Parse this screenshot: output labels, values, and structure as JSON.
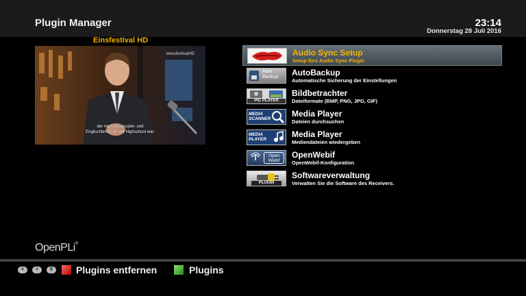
{
  "header": {
    "title": "Plugin Manager",
    "time": "23:14",
    "date": "Donnerstag 28 Juli 2016"
  },
  "preview": {
    "channel": "Einsfestival HD",
    "watermark": "#einsfestivalHD",
    "subtitle_line1": "der mein Schauspiel- und",
    "subtitle_line2": "Englischlehrer an der Highschool war."
  },
  "plugins": [
    {
      "name": "Audio Sync Setup",
      "description": "Setup fürs Audio Sync Plugin",
      "icon": "audio-sync-icon",
      "selected": true
    },
    {
      "name": "AutoBackup",
      "description": "Automatische Sicherung der Einstellungen",
      "icon": "autobackup-icon",
      "icon_text": "Auto Backup",
      "selected": false
    },
    {
      "name": "Bildbetrachter",
      "description": "Dateiformate (BMP, PNG, JPG, GIF)",
      "icon": "pic-player-icon",
      "icon_text": "PIC PLAYER",
      "selected": false
    },
    {
      "name": "Media Player",
      "description": "Dateien durchsuchen",
      "icon": "media-scanner-icon",
      "icon_text": "MEDIA SCANNER",
      "selected": false
    },
    {
      "name": "Media Player",
      "description": "Mediendateien wiedergeben",
      "icon": "media-player-icon",
      "icon_text": "MEDIA PLAYER",
      "selected": false
    },
    {
      "name": "OpenWebif",
      "description": "OpenWebif-Konfiguration",
      "icon": "openwebif-icon",
      "icon_text": "Open Webif",
      "selected": false
    },
    {
      "name": "Softwareverwaltung",
      "description": "Verwalten Sie die Software des Receivers.",
      "icon": "plugin-icon",
      "icon_text": "PLUGIN",
      "selected": false
    }
  ],
  "branding": {
    "logo": "OpenPLi",
    "logo_mark": "®"
  },
  "footer": {
    "key_prev": "<",
    "key_next": ">",
    "key_zero": "0",
    "red_label": "Plugins entfernen",
    "green_label": "Plugins"
  },
  "colors": {
    "accent": "#f6b400",
    "header_bg": "#1b1b1b",
    "red": "#cc0000",
    "green": "#2fa51c"
  }
}
